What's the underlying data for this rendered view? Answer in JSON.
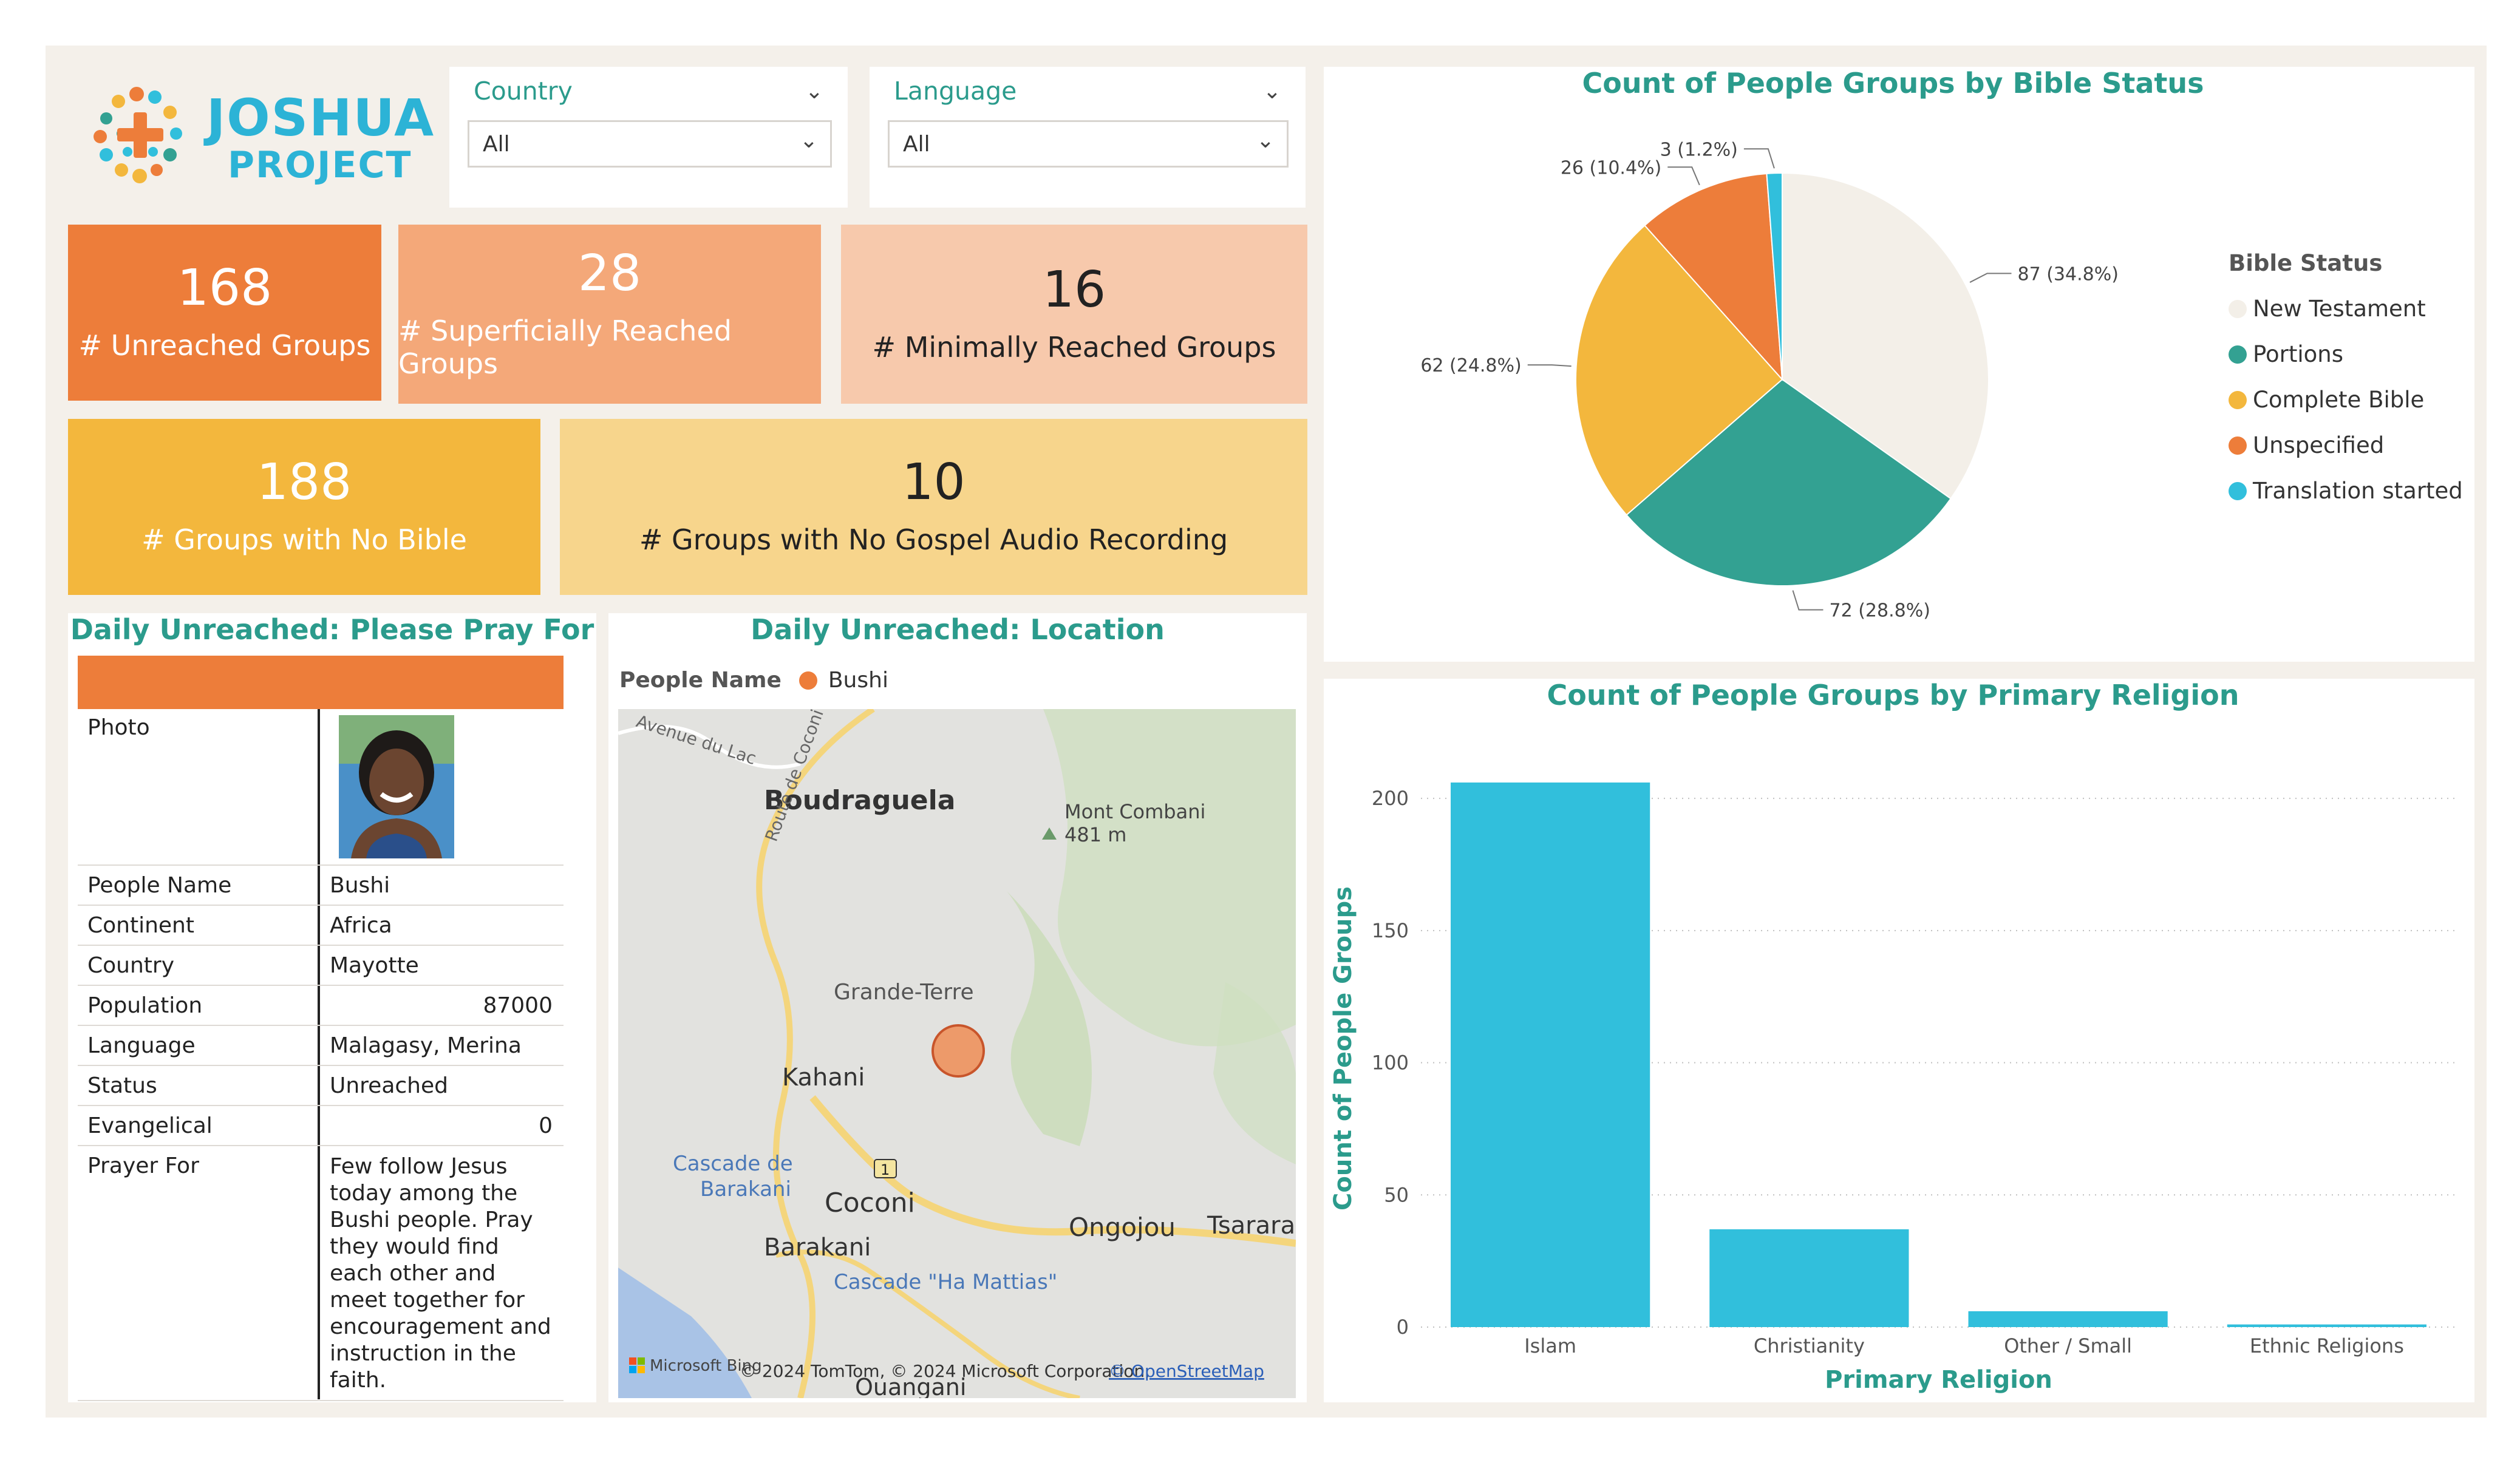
{
  "logo": {
    "line1": "JOSHUA",
    "line2": "PROJECT"
  },
  "filters": [
    {
      "label": "Country",
      "value": "All"
    },
    {
      "label": "Language",
      "value": "All"
    }
  ],
  "kpis": {
    "unreached": {
      "value": "168",
      "label": "# Unreached Groups"
    },
    "superficial": {
      "value": "28",
      "label": "# Superficially Reached Groups"
    },
    "minimal": {
      "value": "16",
      "label": "# Minimally Reached Groups"
    },
    "nobible": {
      "value": "188",
      "label": "# Groups with No Bible"
    },
    "noaudio": {
      "value": "10",
      "label": "# Groups with No Gospel Audio Recording"
    }
  },
  "pray": {
    "title": "Daily Unreached: Please Pray For",
    "photo_label": "Photo",
    "rows": [
      {
        "key": "People Name",
        "value": "Bushi"
      },
      {
        "key": "Continent",
        "value": "Africa"
      },
      {
        "key": "Country",
        "value": "Mayotte"
      },
      {
        "key": "Population",
        "value": "87000"
      },
      {
        "key": "Language",
        "value": "Malagasy, Merina"
      },
      {
        "key": "Status",
        "value": "Unreached"
      },
      {
        "key": "Evangelical",
        "value": "0"
      }
    ],
    "prayer_label": "Prayer For",
    "prayer_text": "Few follow Jesus today among the Bushi people. Pray they would find each other and meet together for encouragement and instruction in the faith."
  },
  "map": {
    "title": "Daily Unreached: Location",
    "legend_title": "People Name",
    "legend_item": "Bushi",
    "places": {
      "boudraguela": "Boudraguela",
      "mont": "Mont Combani",
      "mont_elev": "481 m",
      "grande_terre": "Grande-Terre",
      "kahani": "Kahani",
      "cascade1": "Cascade de",
      "cascade1b": "Barakani",
      "coconi": "Coconi",
      "ongojou": "Ongojou",
      "tsararano": "Tsararar",
      "barakani": "Barakani",
      "cascade2": "Cascade \"Ha Mattias\"",
      "ouangani": "Ouangani",
      "avenue": "Avenue du Lac",
      "route": "Route de Coconi",
      "road_num": "1"
    },
    "attrib_brand": "Microsoft Bing",
    "attrib_text": "© 2024 TomTom, © 2024 Microsoft Corporation,",
    "attrib_link": "© OpenStreetMap"
  },
  "pie": {
    "title": "Count of People Groups by Bible Status",
    "legend_title": "Bible Status"
  },
  "bar": {
    "title": "Count of People Groups by Primary Religion"
  },
  "colors": {
    "teal": "#2b9b8c",
    "orange": "#ed7d3a",
    "bar": "#31bfdc"
  },
  "chart_data": [
    {
      "type": "pie",
      "title": "Count of People Groups by Bible Status",
      "legend_title": "Bible Status",
      "series": [
        {
          "name": "New Testament",
          "value": 87,
          "label": "87 (34.8%)",
          "color": "#f3efe8"
        },
        {
          "name": "Portions",
          "value": 72,
          "label": "72 (28.8%)",
          "color": "#33a192"
        },
        {
          "name": "Complete Bible",
          "value": 62,
          "label": "62 (24.8%)",
          "color": "#f3b73d"
        },
        {
          "name": "Unspecified",
          "value": 26,
          "label": "26 (10.4%)",
          "color": "#ed7d3a"
        },
        {
          "name": "Translation started",
          "value": 3,
          "label": "3 (1.2%)",
          "color": "#31bfdc"
        }
      ]
    },
    {
      "type": "bar",
      "title": "Count of People Groups by Primary Religion",
      "xlabel": "Primary Religion",
      "ylabel": "Count of People Groups",
      "categories": [
        "Islam",
        "Christianity",
        "Other / Small",
        "Ethnic Religions"
      ],
      "values": [
        206,
        37,
        6,
        1
      ],
      "yticks": [
        "0",
        "50",
        "100",
        "150",
        "200"
      ],
      "ylim": [
        0,
        220
      ],
      "grid": true
    }
  ]
}
